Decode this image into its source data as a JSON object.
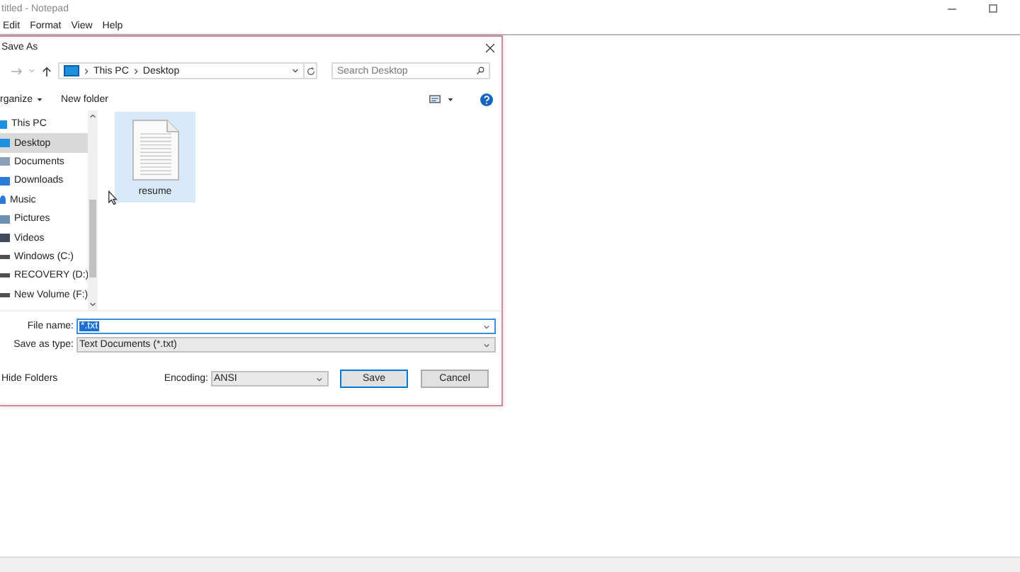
{
  "notepad": {
    "title": "titled - Notepad",
    "menu": [
      "Edit",
      "Format",
      "View",
      "Help"
    ]
  },
  "dialog": {
    "title": "Save As",
    "breadcrumb": [
      "This PC",
      "Desktop"
    ],
    "search": {
      "placeholder": "Search Desktop"
    },
    "toolbar": [
      "rganize",
      "New folder"
    ],
    "tree": [
      {
        "label": "This PC",
        "kind": "pc",
        "selected": false
      },
      {
        "label": "Desktop",
        "kind": "desktop",
        "selected": true
      },
      {
        "label": "Documents",
        "kind": "documents",
        "selected": false
      },
      {
        "label": "Downloads",
        "kind": "downloads",
        "selected": false
      },
      {
        "label": "Music",
        "kind": "music",
        "selected": false
      },
      {
        "label": "Pictures",
        "kind": "pictures",
        "selected": false
      },
      {
        "label": "Videos",
        "kind": "videos",
        "selected": false
      },
      {
        "label": "Windows (C:)",
        "kind": "drive",
        "selected": false
      },
      {
        "label": "RECOVERY (D:)",
        "kind": "drive",
        "selected": false
      },
      {
        "label": "New Volume (F:)",
        "kind": "drive",
        "selected": false
      }
    ],
    "files": [
      {
        "name": "resume",
        "selected": true
      }
    ],
    "file_name_label": "File name:",
    "file_name": "*.txt",
    "type_label": "Save as type:",
    "type": "Text Documents (*.txt)",
    "hide_folders": "Hide Folders",
    "encoding_label": "Encoding:",
    "encoding": "ANSI",
    "buttons": [
      "Save",
      "Cancel"
    ]
  }
}
